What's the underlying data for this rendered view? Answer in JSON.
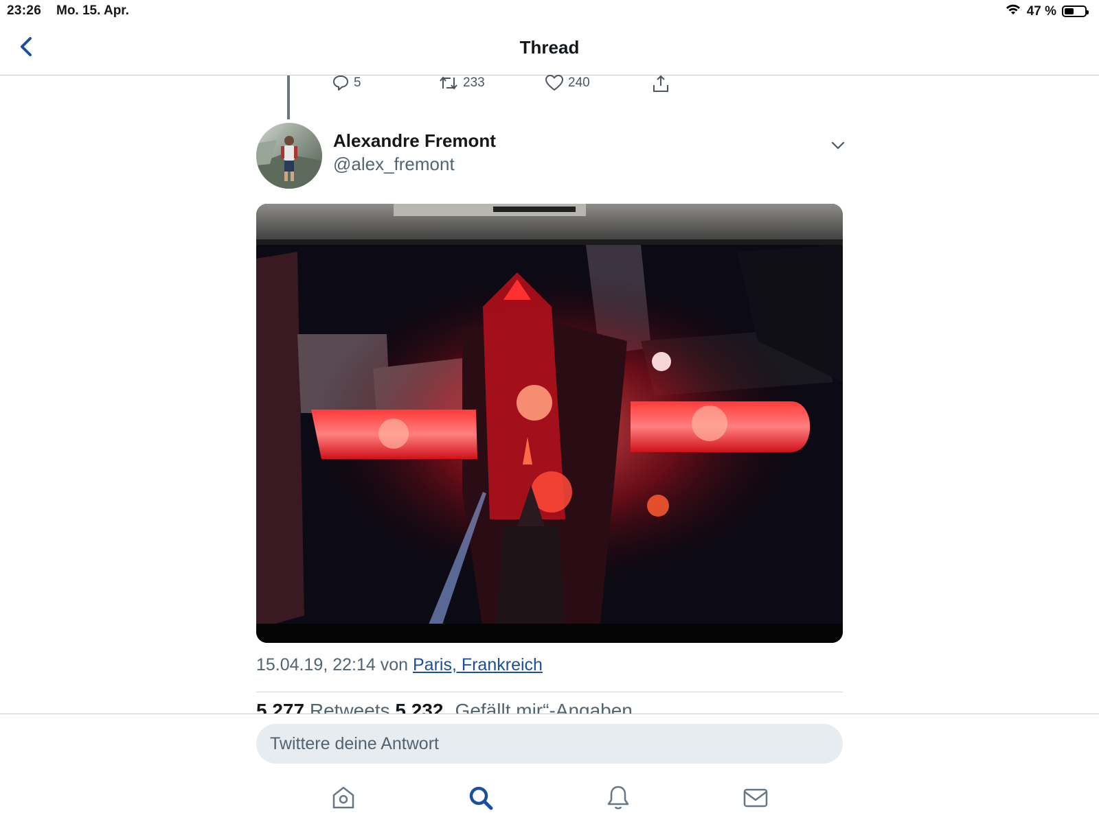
{
  "status_bar": {
    "time": "23:26",
    "date": "Mo. 15. Apr.",
    "battery_text": "47 %",
    "battery_level": 0.47,
    "wifi_icon": "wifi-icon"
  },
  "nav": {
    "title": "Thread",
    "back_icon": "chevron-left-icon"
  },
  "previous_tweet_actions": {
    "replies": "5",
    "retweets": "233",
    "likes": "240"
  },
  "tweet": {
    "author_name": "Alexandre Fremont",
    "author_handle": "@alex_fremont",
    "timestamp_text": "15.04.19, 22:14 von",
    "location": "Paris, Frankreich",
    "retweet_count": "5.277",
    "retweet_label": "Retweets",
    "like_count": "5.232",
    "like_label": "„Gefällt mir“-Angaben"
  },
  "composer": {
    "placeholder": "Twittere deine Antwort"
  },
  "tabs": [
    "home-icon",
    "search-icon",
    "notifications-icon",
    "messages-icon"
  ],
  "colors": {
    "accent": "#1b4f9c",
    "secondary_text": "#536471",
    "input_bg": "#e6ecf0"
  }
}
